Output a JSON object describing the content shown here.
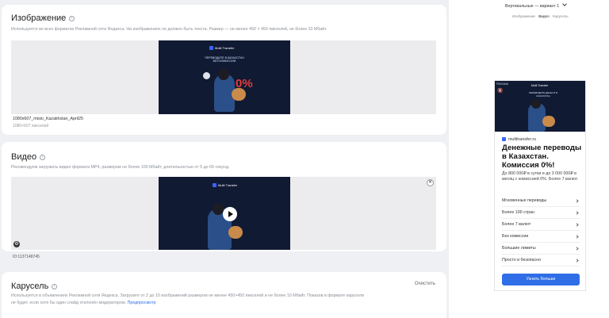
{
  "image_section": {
    "title": "Изображение",
    "description": "Используется во всех форматах Рекламной сети Яндекса. На изображениях не должно быть текста. Размер — не менее 450 × 450 пикселей, не более 10 Мбайт.",
    "file_name": "1080x607_mtsio_Kazakhstan_April25",
    "file_size": "1080×607 пикселей",
    "banner": {
      "logo": "Multi Transfer",
      "text": "ПЕРЕВОДИТЕ В КАЗАХСТАН БЕЗ КОМИССИИ",
      "percent": "0%"
    }
  },
  "video_section": {
    "title": "Видео",
    "description": "Рекомендуем загружать видео формата MP4, размером не более 100 Мбайт, длительностью от 5 до 60 секунд.",
    "video_id": "ID:1137148745",
    "logo": "Multi Transfer"
  },
  "carousel_section": {
    "title": "Карусель",
    "clear_label": "Очистить",
    "description_1": "Используется в объявлениях Рекламной сети Яндекса. Загрузите от 2 до 10 изображений размером не менее 450×450 пикселей и не более 10 Мбайт. Показов в формате карусели",
    "description_2": "не будет, если хотя бы один слайд отклонён модератором.",
    "preview_link": "Предпросмотр"
  },
  "preview": {
    "variant_select": "Вертикальные — вариант 1",
    "format_tabs": [
      "Изображение",
      "Видео",
      "Карусель"
    ],
    "active_tab": "Видео",
    "ad": {
      "label": "РЕКЛАМА",
      "logo": "Multi Transfer",
      "image_text": "ПЕРЕВОДИТЕ ДЕНЬГИ В КАЗАХСТАН",
      "domain": "multitransfer.ru",
      "title": "Денежные переводы в Казахстан. Комиссия 0%!",
      "text": "До 800 000₽ в сутки и до 3 000 000₽ в месяц с комиссией 0%. Более 7 валют.",
      "links": [
        "Мгновенные переводы",
        "Более 100 стран",
        "Более 7 валют",
        "Без комиссии",
        "Большие лимиты",
        "Просто и безопасно"
      ],
      "cta": "Узнать больше"
    }
  },
  "colors": {
    "accent": "#2f6ee6",
    "page_bg": "#eef0f3",
    "banner_bg": "#111a33",
    "percent_red": "#e83a3a"
  }
}
